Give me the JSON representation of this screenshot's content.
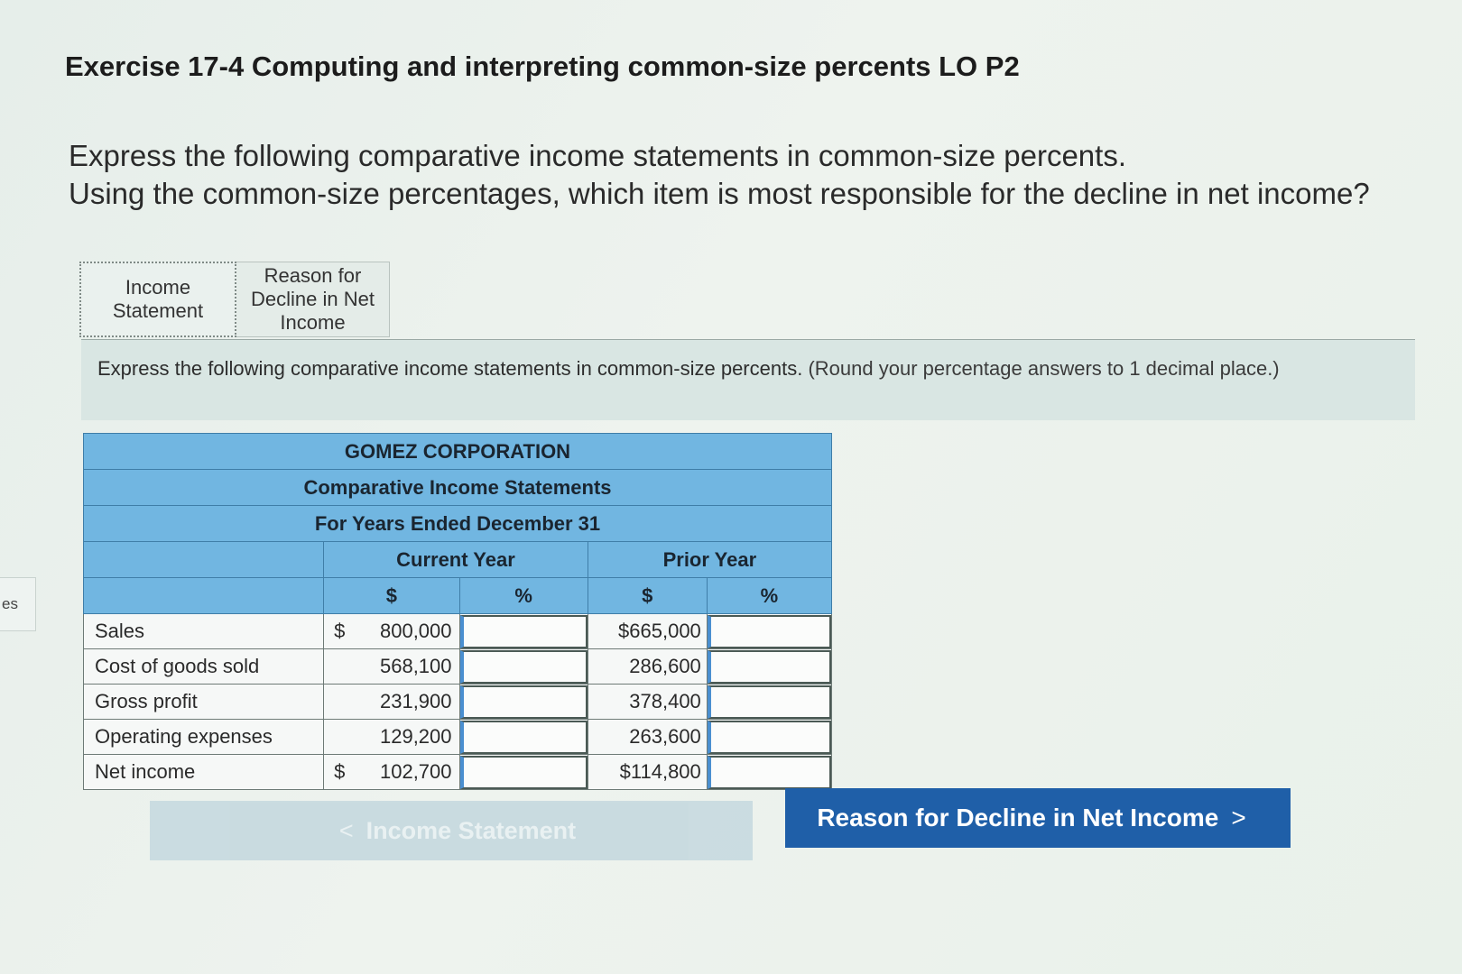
{
  "side_tab": {
    "label": "es"
  },
  "title": "Exercise 17-4 Computing and interpreting common-size percents LO P2",
  "prompt": {
    "line1": "Express the following comparative income statements in common-size percents.",
    "line2": "Using the common-size percentages, which item is most responsible for the decline in net income?"
  },
  "tabs": [
    {
      "label_line1": "Income",
      "label_line2": "Statement"
    },
    {
      "label_line1": "Reason for",
      "label_line2": "Decline in Net",
      "label_line3": "Income"
    }
  ],
  "instructions": {
    "text": "Express the following comparative income statements in common-size percents.",
    "note": "(Round your percentage answers to 1 decimal place.)"
  },
  "statement": {
    "company": "GOMEZ CORPORATION",
    "title": "Comparative Income Statements",
    "period": "For Years Ended December 31",
    "col_current": "Current Year",
    "col_prior": "Prior Year",
    "col_dollar": "$",
    "col_pct": "%",
    "rows": [
      {
        "label": "Sales",
        "cur_sign": "$",
        "cur": "800,000",
        "prior_sign": "$",
        "prior": "665,000"
      },
      {
        "label": "Cost of goods sold",
        "cur_sign": "",
        "cur": "568,100",
        "prior_sign": "",
        "prior": "286,600"
      },
      {
        "label": "Gross profit",
        "cur_sign": "",
        "cur": "231,900",
        "prior_sign": "",
        "prior": "378,400"
      },
      {
        "label": "Operating expenses",
        "cur_sign": "",
        "cur": "129,200",
        "prior_sign": "",
        "prior": "263,600"
      },
      {
        "label": "Net income",
        "cur_sign": "$",
        "cur": "102,700",
        "prior_sign": "$",
        "prior": "114,800"
      }
    ]
  },
  "nav": {
    "prev_label": "Income Statement",
    "prev_chevron": "<",
    "next_label": "Reason for Decline in Net Income",
    "next_chevron": ">"
  },
  "colors": {
    "header_blue": "#71b6e1",
    "next_button": "#1f5fa8"
  }
}
